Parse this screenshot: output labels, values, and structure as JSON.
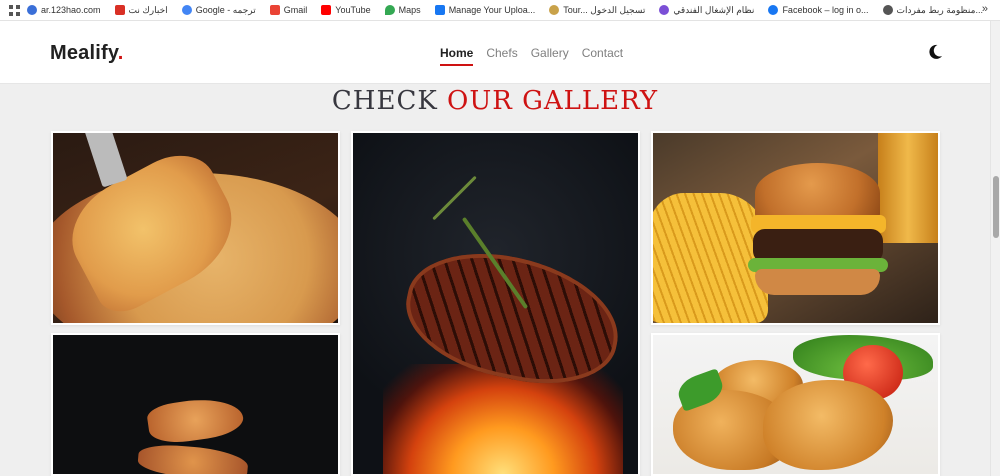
{
  "bookmarks": [
    {
      "label": "ar.123hao.com",
      "color": "#3a6fd8"
    },
    {
      "label": "اخبارك نت",
      "color": "#d93025"
    },
    {
      "label": "Google - ترجمه",
      "color": "#4285f4"
    },
    {
      "label": "Gmail",
      "color": "#ea4335"
    },
    {
      "label": "YouTube",
      "color": "#ff0000"
    },
    {
      "label": "Maps",
      "color": "#34a853"
    },
    {
      "label": "Manage Your Uploa...",
      "color": "#1877f2"
    },
    {
      "label": "Tour... تسجيل الدخول",
      "color": "#c9a24a"
    },
    {
      "label": "نظام الإشغال الفندقي",
      "color": "#7b4fd6"
    },
    {
      "label": "Facebook – log in o...",
      "color": "#1877f2"
    },
    {
      "label": "منظومة ربط مفردات...",
      "color": "#555555"
    }
  ],
  "header": {
    "logo_text": "Mealify",
    "logo_dot": ".",
    "nav": [
      {
        "label": "Home",
        "active": true
      },
      {
        "label": "Chefs",
        "active": false
      },
      {
        "label": "Gallery",
        "active": false
      },
      {
        "label": "Contact",
        "active": false
      }
    ],
    "theme_icon": "moon-icon"
  },
  "gallery": {
    "title_part1": "CHECK",
    "title_part2": "OUR GALLERY",
    "images": [
      "pizza",
      "grilled-steak",
      "burger-and-fries",
      "pizza-slices",
      "fried-chicken"
    ]
  },
  "colors": {
    "accent": "#ce1212",
    "heading": "#37373f",
    "background": "#efefef"
  }
}
